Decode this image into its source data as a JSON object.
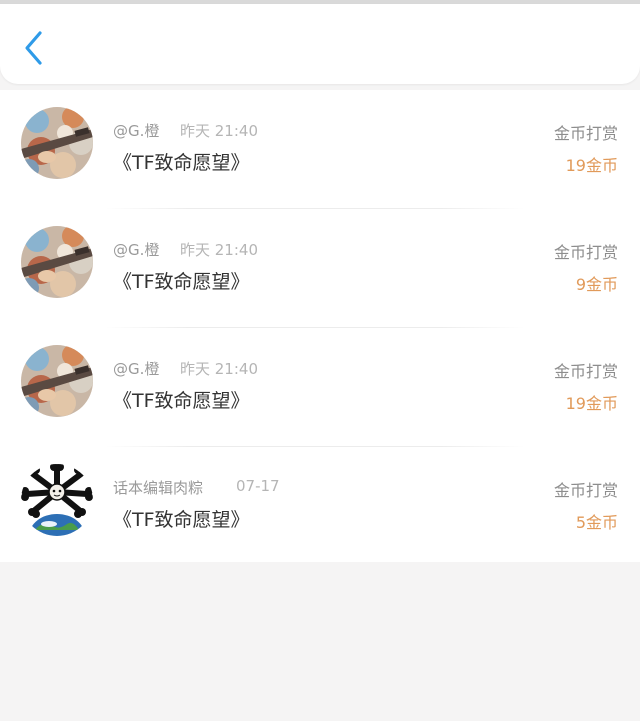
{
  "header": {
    "back_icon": "chevron-left-icon",
    "accent_color": "#2f9be8"
  },
  "records": [
    {
      "username": "@G.橙",
      "time": "昨天 21:40",
      "title": "《TF致命愿望》",
      "action": "金币打赏",
      "amount": "19金币",
      "avatar": "guitar-photo-avatar"
    },
    {
      "username": "@G.橙",
      "time": "昨天 21:40",
      "title": "《TF致命愿望》",
      "action": "金币打赏",
      "amount": "9金币",
      "avatar": "guitar-photo-avatar"
    },
    {
      "username": "@G.橙",
      "time": "昨天 21:40",
      "title": "《TF致命愿望》",
      "action": "金币打赏",
      "amount": "19金币",
      "avatar": "guitar-photo-avatar"
    },
    {
      "username": "话本编辑肉粽",
      "time": "07-17",
      "title": "《TF致命愿望》",
      "action": "金币打赏",
      "amount": "5金币",
      "avatar": "bone-earth-avatar"
    }
  ],
  "colors": {
    "amount": "#e19a5a",
    "label": "#8d8d8d",
    "title": "#333333",
    "background": "#f5f4f4"
  }
}
